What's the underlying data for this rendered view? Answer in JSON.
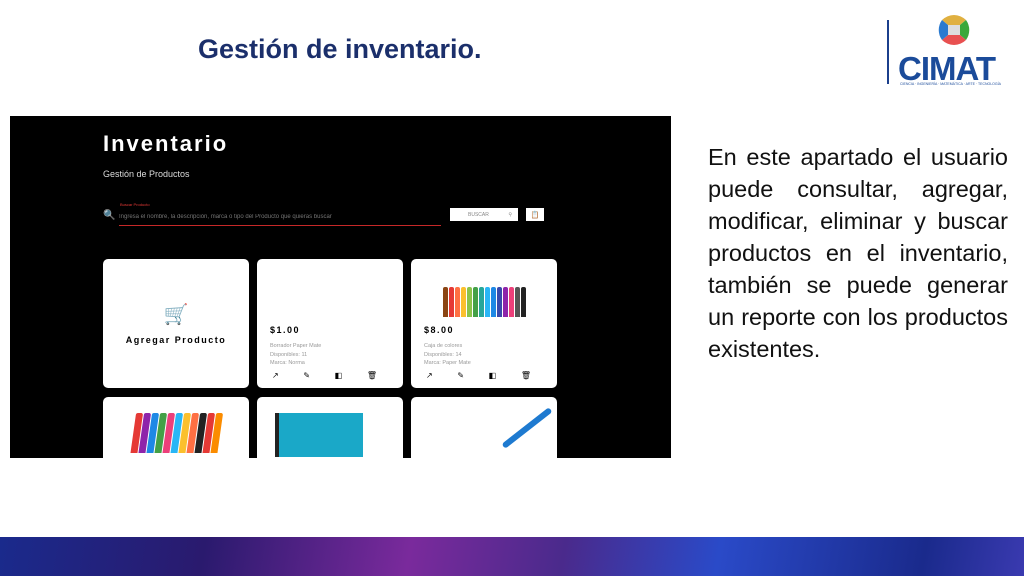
{
  "slide": {
    "title": "Gestión de inventario.",
    "body": "En este apartado el usuario puede consultar, agregar, modificar, eliminar y buscar productos en el inventario, también se puede generar un reporte con los productos existentes."
  },
  "logo": {
    "name": "CIMAT",
    "tagline": "CIENCIA · INGENIERÍA · MATEMÁTICA · ARTE · TECNOLOGÍA"
  },
  "app": {
    "title": "Inventario",
    "subtitle": "Gestión de Productos",
    "search": {
      "label": "Buscar Producto",
      "placeholder": "Ingresa el nombre, la descripción, marca o tipo del Producto que quieras buscar",
      "button": "BUSCAR"
    },
    "add_card": {
      "label": "Agregar Producto"
    },
    "products": [
      {
        "price": "$1.00",
        "name": "Borrador Paper Mate",
        "stock": "Disponibles: 11",
        "brand": "Marca: Norma"
      },
      {
        "price": "$8.00",
        "name": "Caja de colores",
        "stock": "Disponibles: 14",
        "brand": "Marca: Paper Mate"
      }
    ]
  },
  "colors": {
    "title": "#1b2f6b",
    "accent": "#c62828"
  }
}
